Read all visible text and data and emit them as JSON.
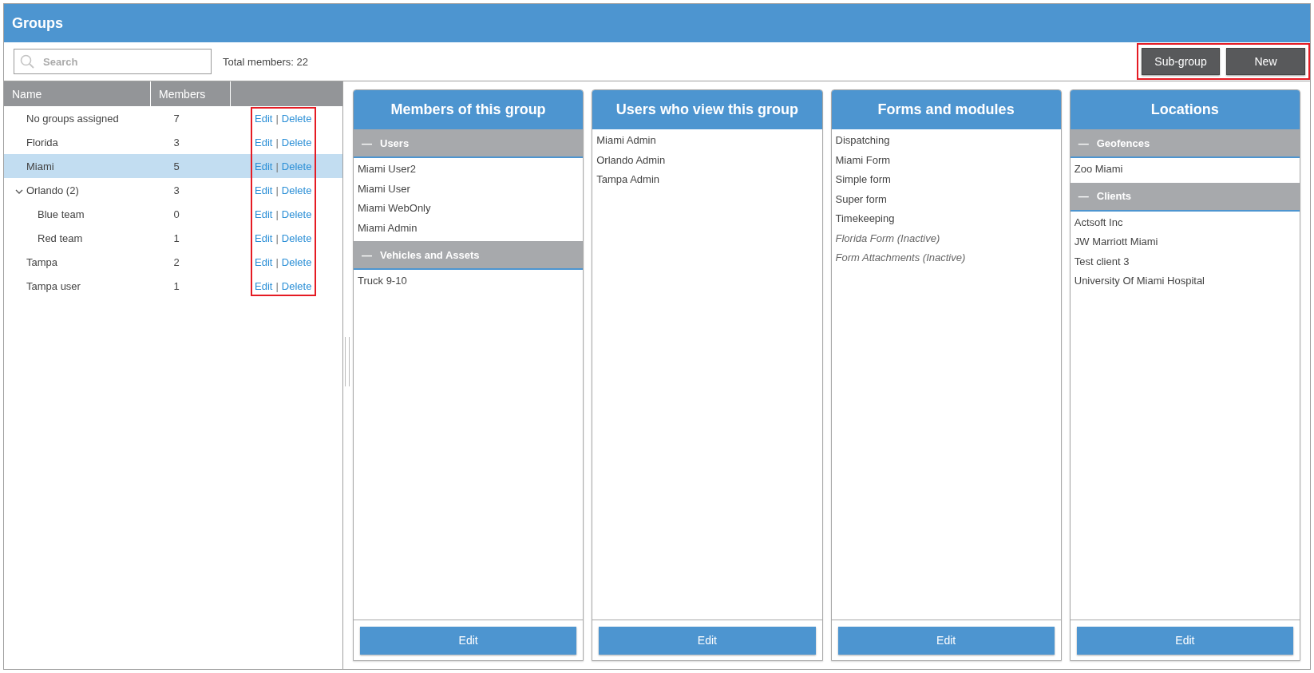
{
  "window": {
    "title": "Groups"
  },
  "search": {
    "placeholder": "Search"
  },
  "total_members": "Total members: 22",
  "toolbar": {
    "highlighted": true,
    "buttons": [
      "Sub-group",
      "New"
    ]
  },
  "table": {
    "columns": [
      "Name",
      "Members"
    ],
    "actions_highlighted": true,
    "rows": [
      {
        "name": "No groups assigned",
        "members": "7",
        "selected": false,
        "actions": {
          "edit": "Edit",
          "separator": "|",
          "delete": "Delete"
        }
      },
      {
        "name": "Florida",
        "members": "3",
        "selected": false,
        "actions": {
          "edit": "Edit",
          "separator": "|",
          "delete": "Delete"
        }
      },
      {
        "name": "Miami",
        "members": "5",
        "selected": true,
        "actions": {
          "edit": "Edit",
          "separator": "|",
          "delete": "Delete"
        }
      },
      {
        "name": "Orlando (2)",
        "members": "3",
        "selected": false,
        "expanded": true,
        "actions": {
          "edit": "Edit",
          "separator": "|",
          "delete": "Delete"
        },
        "children": [
          {
            "name": "Blue team",
            "members": "0",
            "selected": false,
            "actions": {
              "edit": "Edit",
              "separator": "|",
              "delete": "Delete"
            }
          },
          {
            "name": "Red team",
            "members": "1",
            "selected": false,
            "actions": {
              "edit": "Edit",
              "separator": "|",
              "delete": "Delete"
            }
          }
        ]
      },
      {
        "name": "Tampa",
        "members": "2",
        "selected": false,
        "actions": {
          "edit": "Edit",
          "separator": "|",
          "delete": "Delete"
        }
      },
      {
        "name": "Tampa user",
        "members": "1",
        "selected": false,
        "actions": {
          "edit": "Edit",
          "separator": "|",
          "delete": "Delete"
        }
      }
    ]
  },
  "panels": [
    {
      "title": "Members of this group",
      "kind": "sectioned",
      "button": "Edit",
      "sections": [
        {
          "label": "Users",
          "icon": "—",
          "expanded": true,
          "items": [
            {
              "label": "Miami User2",
              "inactive": false
            },
            {
              "label": "Miami User",
              "inactive": false
            },
            {
              "label": "Miami WebOnly",
              "inactive": false
            },
            {
              "label": "Miami Admin",
              "inactive": false
            }
          ]
        },
        {
          "label": "Vehicles and Assets",
          "icon": "—",
          "expanded": true,
          "items": [
            {
              "label": "Truck 9-10",
              "inactive": false
            }
          ]
        }
      ]
    },
    {
      "title": "Users who view this group",
      "kind": "plain",
      "button": "Edit",
      "items": [
        {
          "label": "Miami Admin",
          "inactive": false
        },
        {
          "label": "Orlando Admin",
          "inactive": false
        },
        {
          "label": "Tampa Admin",
          "inactive": false
        }
      ]
    },
    {
      "title": "Forms and modules",
      "kind": "plain",
      "button": "Edit",
      "items": [
        {
          "label": "Dispatching",
          "inactive": false
        },
        {
          "label": "Miami Form",
          "inactive": false
        },
        {
          "label": "Simple form",
          "inactive": false
        },
        {
          "label": "Super form",
          "inactive": false
        },
        {
          "label": "Timekeeping",
          "inactive": false
        },
        {
          "label": "Florida Form (Inactive)",
          "inactive": true
        },
        {
          "label": "Form Attachments (Inactive)",
          "inactive": true
        }
      ]
    },
    {
      "title": "Locations",
      "kind": "sectioned",
      "button": "Edit",
      "sections": [
        {
          "label": "Geofences",
          "icon": "—",
          "expanded": true,
          "items": [
            {
              "label": "Zoo Miami",
              "inactive": false
            }
          ]
        },
        {
          "label": "Clients",
          "icon": "—",
          "expanded": true,
          "items": [
            {
              "label": "Actsoft Inc",
              "inactive": false
            },
            {
              "label": "JW Marriott Miami",
              "inactive": false
            },
            {
              "label": "Test client 3",
              "inactive": false
            },
            {
              "label": "University Of Miami Hospital",
              "inactive": false
            }
          ]
        }
      ]
    }
  ]
}
